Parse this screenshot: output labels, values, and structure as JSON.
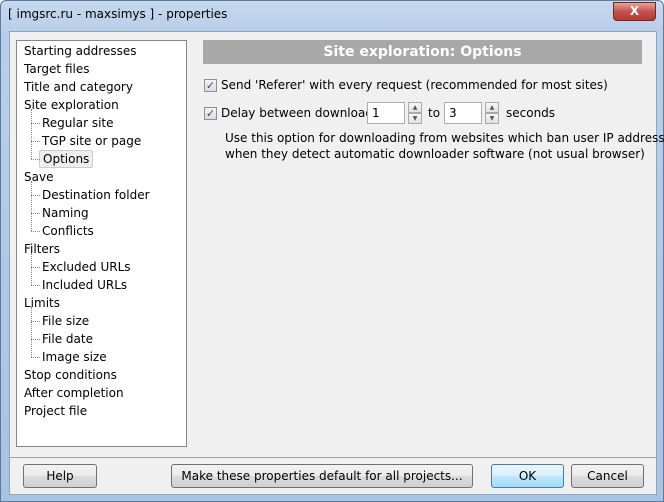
{
  "window": {
    "title": "[ imgsrc.ru - maxsimys ] - properties",
    "close_glyph": "X"
  },
  "tree": {
    "items": [
      {
        "label": "Starting addresses",
        "level": 0
      },
      {
        "label": "Target files",
        "level": 0
      },
      {
        "label": "Title and category",
        "level": 0
      },
      {
        "label": "Site exploration",
        "level": 0
      },
      {
        "label": "Regular site",
        "level": 1
      },
      {
        "label": "TGP site or page",
        "level": 1
      },
      {
        "label": "Options",
        "level": 1,
        "selected": true
      },
      {
        "label": "Save",
        "level": 0
      },
      {
        "label": "Destination folder",
        "level": 1
      },
      {
        "label": "Naming",
        "level": 1
      },
      {
        "label": "Conflicts",
        "level": 1
      },
      {
        "label": "Filters",
        "level": 0
      },
      {
        "label": "Excluded URLs",
        "level": 1
      },
      {
        "label": "Included URLs",
        "level": 1
      },
      {
        "label": "Limits",
        "level": 0
      },
      {
        "label": "File size",
        "level": 1
      },
      {
        "label": "File date",
        "level": 1
      },
      {
        "label": "Image size",
        "level": 1
      },
      {
        "label": "Stop conditions",
        "level": 0
      },
      {
        "label": "After completion",
        "level": 0
      },
      {
        "label": "Project file",
        "level": 0
      }
    ]
  },
  "panel": {
    "header": "Site exploration: Options",
    "send_referer": {
      "label": "Send 'Referer' with every request (recommended for most sites)",
      "checked": true
    },
    "delay": {
      "label": "Delay between downloads",
      "checked": true,
      "from": "1",
      "to_label": "to",
      "to": "3",
      "unit": "seconds"
    },
    "note_line1": "Use this option for downloading from websites which ban user IP address",
    "note_line2": "when they detect automatic downloader software (not usual browser)"
  },
  "buttons": {
    "help": "Help",
    "make_default": "Make these properties default for all projects...",
    "ok": "OK",
    "cancel": "Cancel"
  },
  "check_glyph": "✓"
}
